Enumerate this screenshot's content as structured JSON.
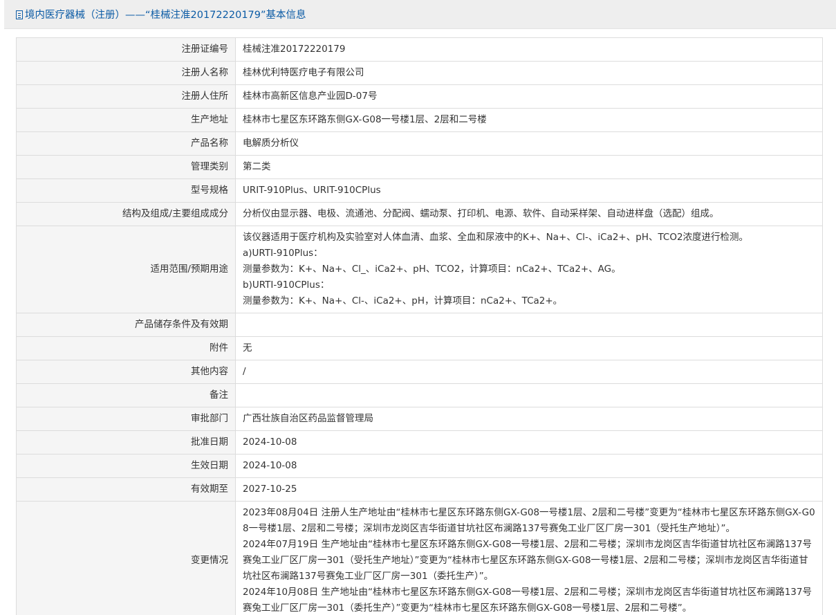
{
  "title": {
    "icon": "document-icon",
    "text": "境内医疗器械（注册）——“桂械注准20172220179”基本信息"
  },
  "rows": [
    {
      "label": "注册证编号",
      "value": "桂械注准20172220179"
    },
    {
      "label": "注册人名称",
      "value": "桂林优利特医疗电子有限公司"
    },
    {
      "label": "注册人住所",
      "value": "桂林市高新区信息产业园D-07号"
    },
    {
      "label": "生产地址",
      "value": "桂林市七星区东环路东侧GX-G08一号楼1层、2层和二号楼"
    },
    {
      "label": "产品名称",
      "value": "电解质分析仪"
    },
    {
      "label": "管理类别",
      "value": "第二类"
    },
    {
      "label": "型号规格",
      "value": "URIT-910Plus、URIT-910CPlus"
    },
    {
      "label": "结构及组成/主要组成成分",
      "value": "分析仪由显示器、电极、流通池、分配阀、蠕动泵、打印机、电源、软件、自动采样架、自动进样盘（选配）组成。"
    },
    {
      "label": "适用范围/预期用途",
      "lines": [
        "该仪器适用于医疗机构及实验室对人体血清、血浆、全血和尿液中的K+、Na+、Cl-、iCa2+、pH、TCO2浓度进行检测。",
        "a)URTI-910Plus：",
        "测量参数为：K+、Na+、Cl_、iCa2+、pH、TCO2，计算项目：nCa2+、TCa2+、AG。",
        "b)URTI-910CPlus：",
        "测量参数为：K+、Na+、Cl-、iCa2+、pH，计算项目：nCa2+、TCa2+。"
      ]
    },
    {
      "label": "产品储存条件及有效期",
      "value": ""
    },
    {
      "label": "附件",
      "value": "无"
    },
    {
      "label": "其他内容",
      "value": "/"
    },
    {
      "label": "备注",
      "value": ""
    },
    {
      "label": "审批部门",
      "value": "广西壮族自治区药品监督管理局"
    },
    {
      "label": "批准日期",
      "value": "2024-10-08"
    },
    {
      "label": "生效日期",
      "value": "2024-10-08"
    },
    {
      "label": "有效期至",
      "value": "2027-10-25"
    },
    {
      "label": "变更情况",
      "lines": [
        "2023年08月04日 注册人生产地址由“桂林市七星区东环路东侧GX-G08一号楼1层、2层和二号楼”变更为“桂林市七星区东环路东侧GX-G08一号楼1层、2层和二号楼；深圳市龙岗区吉华街道甘坑社区布澜路137号赛兔工业厂区厂房一301（受托生产地址）”。",
        "2024年07月19日 生产地址由“桂林市七星区东环路东侧GX-G08一号楼1层、2层和二号楼；深圳市龙岗区吉华街道甘坑社区布澜路137号赛兔工业厂区厂房一301（受托生产地址）”变更为“桂林市七星区东环路东侧GX-G08一号楼1层、2层和二号楼；深圳市龙岗区吉华街道甘坑社区布澜路137号赛兔工业厂区厂房一301（委托生产）”。",
        "2024年10月08日 生产地址由“桂林市七星区东环路东侧GX-G08一号楼1层、2层和二号楼；深圳市龙岗区吉华街道甘坑社区布澜路137号赛兔工业厂区厂房一301（委托生产）”变更为“桂林市七星区东环路东侧GX-G08一号楼1层、2层和二号楼”。"
      ]
    }
  ]
}
